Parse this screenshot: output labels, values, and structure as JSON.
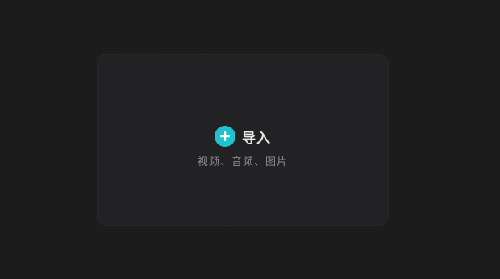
{
  "dropzone": {
    "import_label": "导入",
    "subtitle": "视频、音频、图片",
    "icon": "plus-circle-icon",
    "accent_color": "#1fc3cf"
  }
}
